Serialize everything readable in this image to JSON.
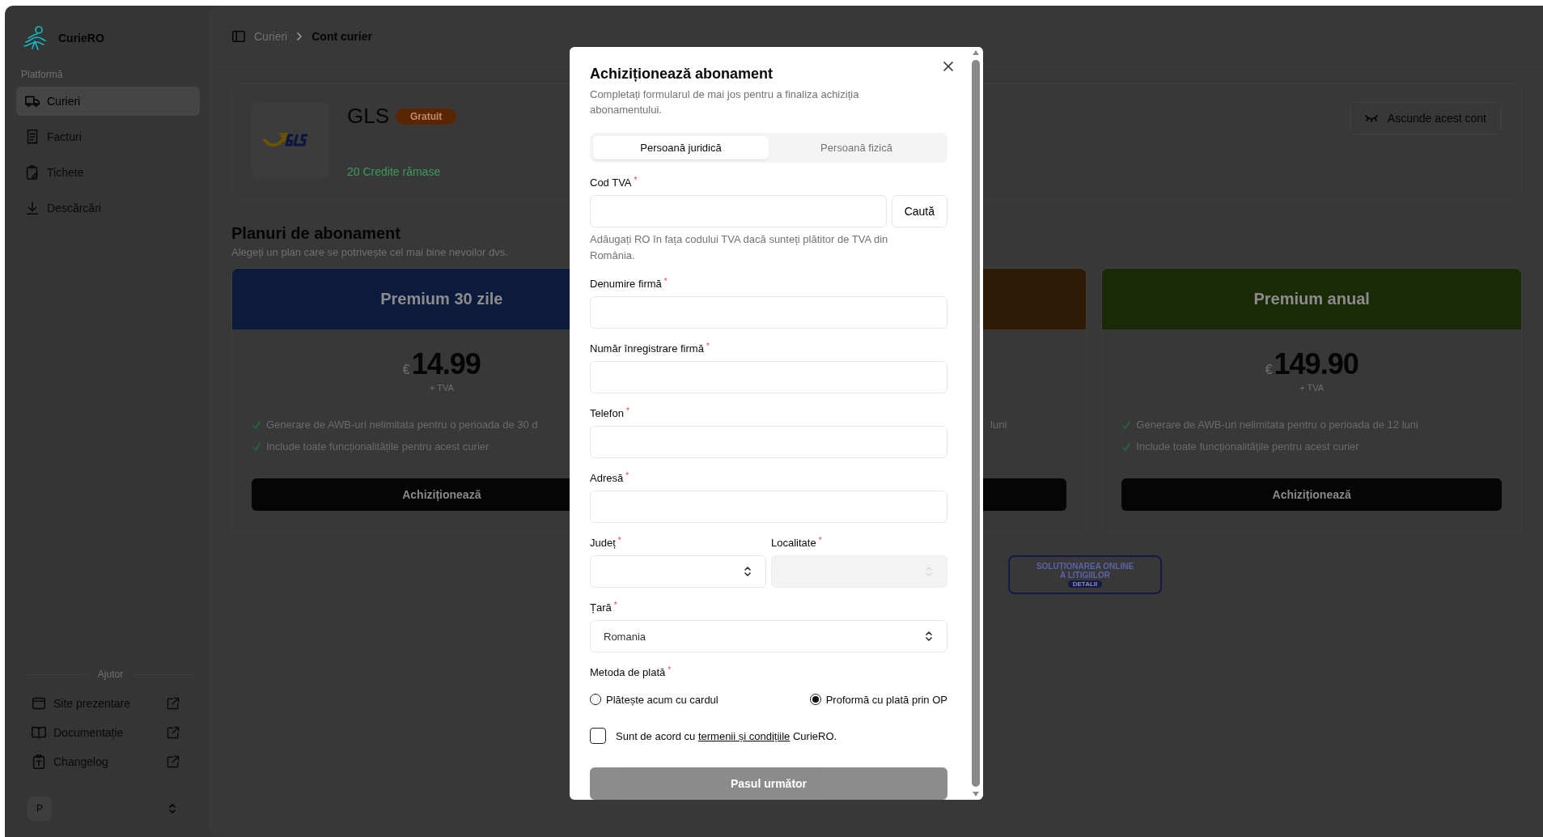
{
  "sidebar": {
    "brand": "CurieRO",
    "section": "Platformă",
    "items": [
      {
        "label": "Curieri",
        "selected": true
      },
      {
        "label": "Facturi",
        "selected": false
      },
      {
        "label": "Tichete",
        "selected": false
      },
      {
        "label": "Descărcări",
        "selected": false
      }
    ],
    "help_title": "Ajutor",
    "help_links": [
      {
        "label": "Site prezentare"
      },
      {
        "label": "Documentație"
      },
      {
        "label": "Changelog"
      }
    ],
    "user": {
      "initial": "P"
    }
  },
  "breadcrumb": [
    "Curieri",
    "Cont curier"
  ],
  "courier": {
    "name": "GLS",
    "badge": "Gratuit",
    "credits": "20 Credite rămase",
    "hide_button": "Ascunde acest cont"
  },
  "plans_section": {
    "title": "Planuri de abonament",
    "subtitle": "Alegeți un plan care se potrivește cel mai bine nevoilor dvs."
  },
  "plans": [
    {
      "title": "Premium 30 zile",
      "color": "#0c1a3b",
      "currency": "€",
      "price": "14.99",
      "tax": "+ TVA",
      "features": [
        "Generare de AWB-uri nelimitata pentru o perioada de 30 d",
        "Include toate funcționalitățile pentru acest curier"
      ],
      "button": "Achiziționează"
    },
    {
      "color": "#2e1a05",
      "features": [
        "luni"
      ]
    },
    {
      "title": "Premium anual",
      "color": "#1a2a07",
      "currency": "€",
      "price": "149.90",
      "tax": "+ TVA",
      "features": [
        "Generare de AWB-uri nelimitata pentru o perioada de 12 luni",
        "Include toate funcționalitățile pentru acest curier"
      ],
      "button": "Achiziționează"
    }
  ],
  "footer_badge": {
    "title": "SOLUȚIONAREA ONLINE A LITIGIILOR",
    "button": "DETALII"
  },
  "dialog": {
    "title": "Achiziționează abonament",
    "subtitle": "Completați formularul de mai jos pentru a finaliza achiziția abonamentului.",
    "tabs": [
      {
        "label": "Persoană juridică",
        "selected": true
      },
      {
        "label": "Persoană fizică",
        "selected": false
      }
    ],
    "fields": [
      {
        "kind": "search",
        "label": "Cod TVA",
        "required_mark": "*",
        "button": "Caută",
        "hint": "Adăugați RO în fața codului TVA dacă sunteți plătitor de TVA din România."
      },
      {
        "kind": "text",
        "label": "Denumire firmă",
        "required_mark": "*"
      },
      {
        "kind": "text",
        "label": "Număr înregistrare firmă",
        "required_mark": "*"
      },
      {
        "kind": "text",
        "label": "Telefon",
        "required_mark": "*"
      },
      {
        "kind": "text",
        "label": "Adresă",
        "required_mark": "*"
      },
      {
        "kind": "pair",
        "fields": [
          {
            "kind": "select",
            "label": "Județ",
            "required_mark": "*",
            "disabled": false
          },
          {
            "kind": "select",
            "label": "Localitate",
            "required_mark": "*",
            "disabled": true
          }
        ]
      },
      {
        "kind": "select",
        "label": "Țară",
        "required_mark": "*",
        "value": "Romania",
        "disabled": false
      }
    ],
    "payment": {
      "label": "Metoda de plată",
      "required_mark": "*",
      "options": [
        {
          "label": "Plătește acum cu cardul",
          "selected": false
        },
        {
          "label": "Proformă cu plată prin OP",
          "selected": true
        }
      ]
    },
    "agreement": {
      "checked": false,
      "text_before": "Sunt de acord cu",
      "link": "termenii și condițiile",
      "text_after": "CurieRO."
    },
    "submit": {
      "label": "Pasul următor",
      "disabled": true
    }
  }
}
